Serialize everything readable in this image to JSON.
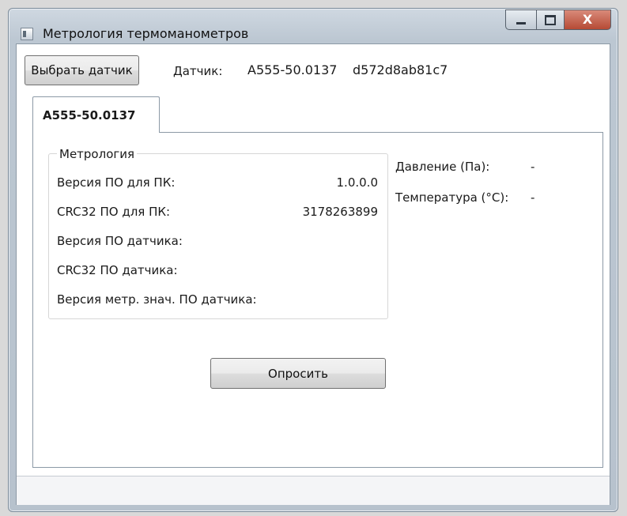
{
  "window": {
    "title": "Метрология термоманометров",
    "close_glyph": "X"
  },
  "toolbar": {
    "select_sensor_label": "Выбрать датчик",
    "sensor_label": "Датчик:",
    "sensor_model": "A555-50.0137",
    "sensor_id": "d572d8ab81c7"
  },
  "tabs": [
    {
      "label": "A555-50.0137",
      "selected": true
    }
  ],
  "metrology": {
    "group_title": "Метрология",
    "rows": [
      {
        "label": "Версия ПО для ПК:",
        "value": "1.0.0.0"
      },
      {
        "label": "CRC32 ПО для ПК:",
        "value": "3178263899"
      },
      {
        "label": "Версия ПО датчика:",
        "value": ""
      },
      {
        "label": "CRC32 ПО датчика:",
        "value": ""
      },
      {
        "label": "Версия метр. знач. ПО датчика:",
        "value": ""
      }
    ]
  },
  "readings": {
    "pressure_label": "Давление (Па):",
    "pressure_value": "-",
    "temperature_label": "Температура (°C):",
    "temperature_value": "-"
  },
  "actions": {
    "poll_label": "Опросить"
  },
  "icons": [
    "app-icon",
    "minimize-icon",
    "maximize-icon",
    "close-icon"
  ]
}
